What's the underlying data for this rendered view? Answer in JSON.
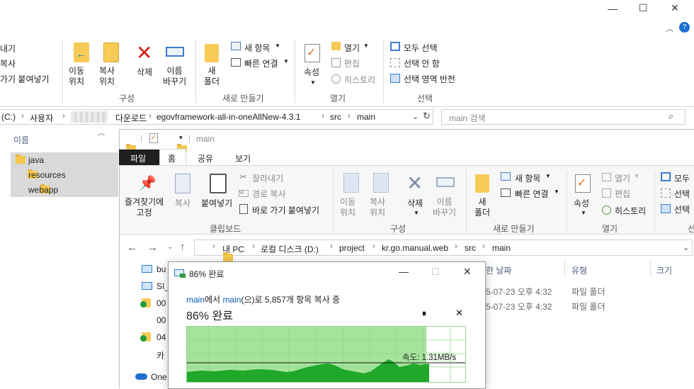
{
  "back_window": {
    "title_controls": {
      "minimize": "—",
      "maximize": "☐",
      "close": "✕"
    },
    "ribbon": {
      "clipboard_partial": [
        "내기",
        "복사",
        "가기 붙여넣기"
      ],
      "organize": {
        "move_to": "이동\n위치",
        "copy_to": "복사\n위치",
        "delete": "삭제",
        "rename": "이름\n바꾸기",
        "group": "구성"
      },
      "new": {
        "new_folder": "새\n폴더",
        "new_item": "새 항목",
        "easy_access": "빠른 연결",
        "group": "새로 만들기"
      },
      "open": {
        "properties": "속성",
        "open": "열기",
        "edit": "편집",
        "history": "히스토리",
        "group": "열기"
      },
      "select": {
        "select_all": "모두 선택",
        "select_none": "선택 안 함",
        "invert": "선택 영역 반전",
        "group": "선택"
      }
    },
    "address": {
      "segments": [
        "(C:)",
        "사용자",
        "다운로드",
        "egovframework-all-in-oneAllNew-4.3.1",
        "src",
        "main"
      ],
      "search_placeholder": "main 검색"
    },
    "column_name": "이름",
    "items": [
      "java",
      "resources",
      "webapp"
    ]
  },
  "front_window": {
    "title": "main",
    "tabs": [
      "파일",
      "홈",
      "공유",
      "보기"
    ],
    "ribbon": {
      "clipboard": {
        "pin": "즐겨찾기에\n고정",
        "copy": "복사",
        "paste": "붙여넣기",
        "cut": "잘라내기",
        "copy_path": "경로 복사",
        "paste_shortcut": "바로 가기 붙여넣기",
        "group": "클립보드"
      },
      "organize": {
        "move_to": "이동\n위치",
        "copy_to": "복사\n위치",
        "delete": "삭제",
        "rename": "이름\n바꾸기",
        "group": "구성"
      },
      "new": {
        "new_folder": "새\n폴더",
        "new_item": "새 항목",
        "easy_access": "빠른 연결",
        "group": "새로 만들기"
      },
      "open": {
        "properties": "속성",
        "open": "열기",
        "edit": "편집",
        "history": "히스토리",
        "group": "열기"
      },
      "select": {
        "select_all": "모두",
        "select_none": "선택",
        "invert": "선택",
        "group": "선"
      }
    },
    "address": {
      "segments": [
        "내 PC",
        "로컬 디스크 (D:)",
        "project",
        "kr.go.manual.web",
        "src",
        "main"
      ]
    },
    "columns": {
      "date": "한 날짜",
      "type": "유형",
      "size": "크기"
    },
    "nav_items": [
      "bu",
      "SI_",
      "00",
      "00",
      "04",
      "카",
      "One"
    ],
    "rows": [
      {
        "date": "5-07-23 오후 4:32",
        "type": "파일 폴더"
      },
      {
        "date": "5-07-23 오후 4:32",
        "type": "파일 폴더"
      }
    ]
  },
  "copy_dialog": {
    "title": "86% 완료",
    "from": "main",
    "from_suffix": "에서 ",
    "to": "main",
    "to_suffix": "(으)로 5,857개 항목 복사 중",
    "progress_label": "86% 완료",
    "progress": 0.86,
    "speed": "속도: 1.31MB/s",
    "pause": "⏸",
    "cancel": "✕"
  }
}
